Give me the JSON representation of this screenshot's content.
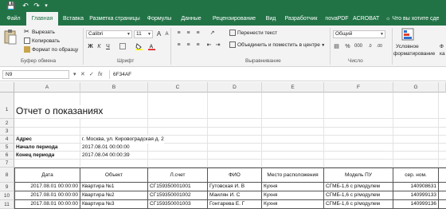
{
  "quick_access": {
    "save": "💾",
    "undo": "↶",
    "redo": "↷",
    "customize": "▾"
  },
  "tabs": [
    "Файл",
    "Главная",
    "Вставка",
    "Разметка страницы",
    "Формулы",
    "Данные",
    "Рецензирование",
    "Вид",
    "Разработчик",
    "novaPDF",
    "ACROBAT"
  ],
  "tell_me": "Что вы хотите сде",
  "ribbon": {
    "clipboard": {
      "cut": "Вырезать",
      "copy": "Копировать",
      "format_painter": "Формат по образцу",
      "group": "Буфер обмена"
    },
    "font": {
      "name": "Calibri",
      "size": "11",
      "group": "Шрифт",
      "bold": "Ж",
      "italic": "К",
      "underline": "Ч",
      "grow": "A",
      "shrink": "A"
    },
    "alignment": {
      "wrap": "Перенести текст",
      "merge": "Объединить и поместить в центре",
      "group": "Выравнивание"
    },
    "number": {
      "format": "Общий",
      "group": "Число",
      "percent": "%",
      "thousands": "000"
    },
    "styles": {
      "conditional": "Условное",
      "conditional2": "форматирование",
      "format_as": "Ф",
      "format_as2": "ка"
    }
  },
  "formula_bar": {
    "name_box": "N9",
    "fx": "fx",
    "content": "6F34AF"
  },
  "columns": [
    "A",
    "B",
    "C",
    "D",
    "E",
    "F",
    "G"
  ],
  "rows": [
    "1",
    "2",
    "3",
    "4",
    "5",
    "6",
    "7",
    "8",
    "9",
    "10",
    "11"
  ],
  "sheet": {
    "title": "Отчет о показаниях",
    "address_label": "Адрес",
    "address_value": "г. Москва, ул. Кировоградская д. 2",
    "start_label": "Начало периода",
    "start_value": "2017.08.01 00:00:00",
    "end_label": "Конец периода",
    "end_value": "2017.08.04 00:00:39",
    "headers": [
      "Дата",
      "Объект",
      "Л.счет",
      "ФИО",
      "Место расположения",
      "Модель ПУ",
      "сер. ном."
    ],
    "data": [
      [
        "2017.08.01 00:00:00",
        "Квартира №1",
        "СГ159350001001",
        "Гутовская И. В",
        "Кухня",
        "СГМБ-1,6 с р/модулем",
        "140908631"
      ],
      [
        "2017.08.01 00:00:00",
        "Квартира №2",
        "СГ159350001002",
        "Маилян И. С",
        "Кухня",
        "СГМБ-1,6 с р/модулем",
        "140999133"
      ],
      [
        "2017.08.01 00:00:00",
        "Квартира №3",
        "СГ159350001003",
        "Гонтарева Е. Г",
        "Кухня",
        "СГМБ-1,6 с р/модулем",
        "140999136"
      ]
    ]
  }
}
